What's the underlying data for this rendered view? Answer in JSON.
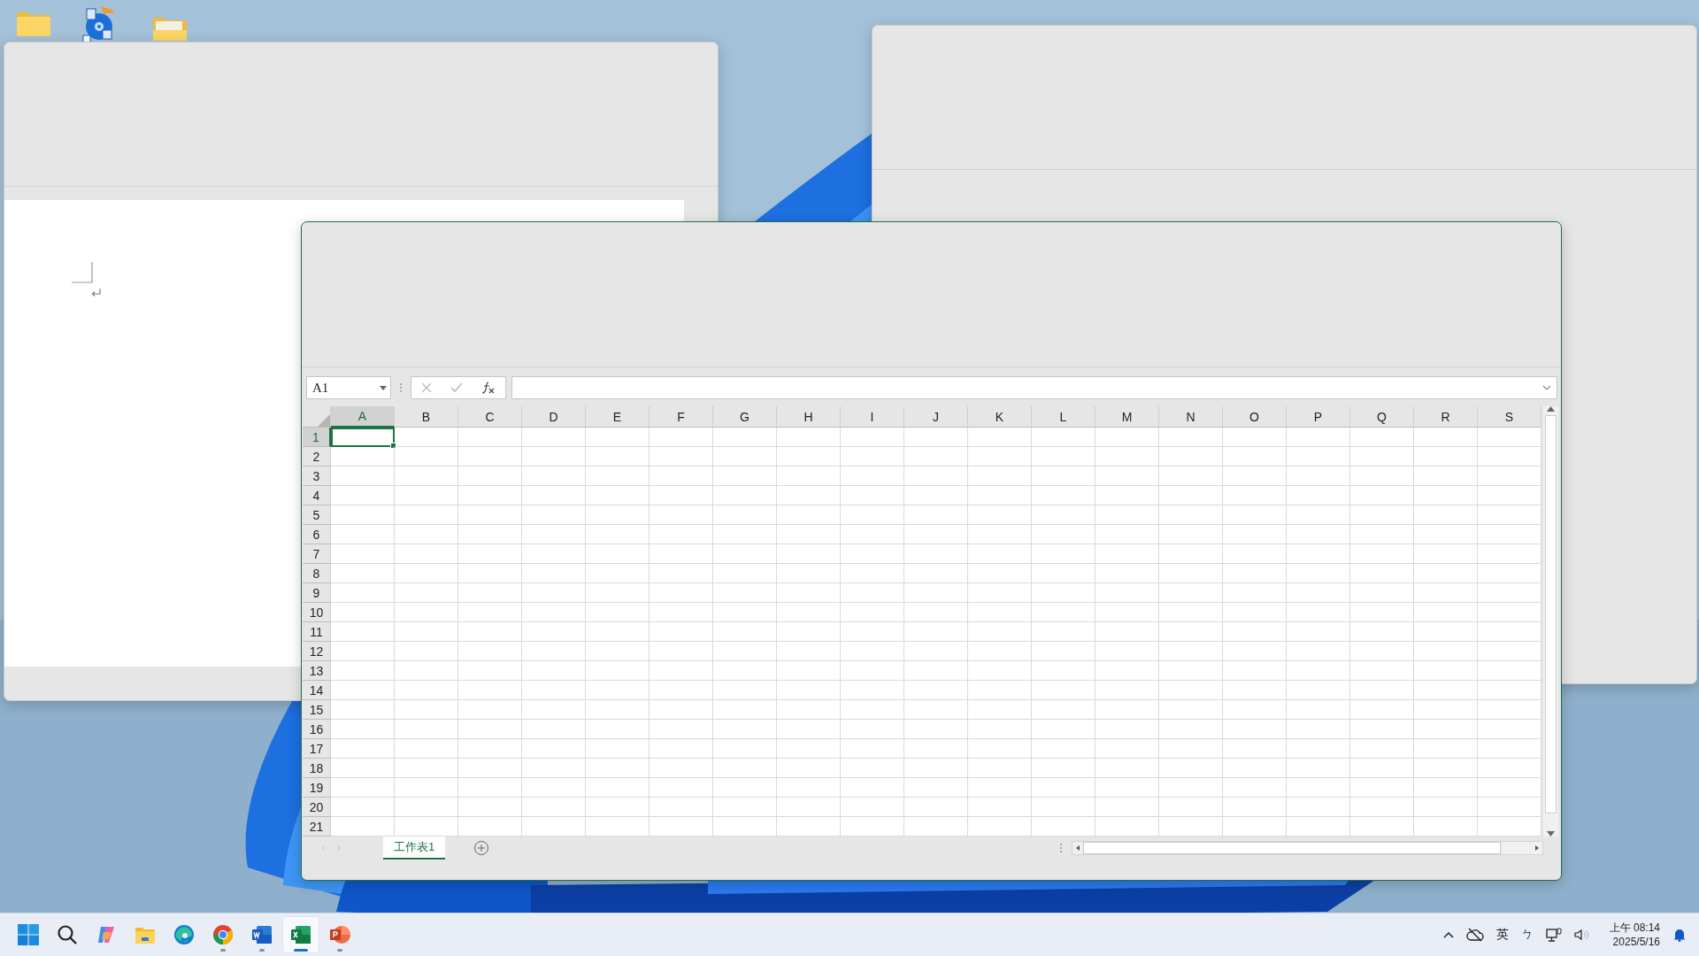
{
  "desktop_icons": [
    {
      "kind": "folder"
    },
    {
      "kind": "disc"
    },
    {
      "kind": "folder-open"
    }
  ],
  "excel": {
    "name_box": "A1",
    "columns": [
      {
        "label": "A",
        "selected": true
      },
      {
        "label": "B",
        "selected": false
      },
      {
        "label": "C",
        "selected": false
      },
      {
        "label": "D",
        "selected": false
      },
      {
        "label": "E",
        "selected": false
      },
      {
        "label": "F",
        "selected": false
      },
      {
        "label": "G",
        "selected": false
      },
      {
        "label": "H",
        "selected": false
      },
      {
        "label": "I",
        "selected": false
      },
      {
        "label": "J",
        "selected": false
      },
      {
        "label": "K",
        "selected": false
      },
      {
        "label": "L",
        "selected": false
      },
      {
        "label": "M",
        "selected": false
      },
      {
        "label": "N",
        "selected": false
      },
      {
        "label": "O",
        "selected": false
      },
      {
        "label": "P",
        "selected": false
      },
      {
        "label": "Q",
        "selected": false
      },
      {
        "label": "R",
        "selected": false
      },
      {
        "label": "S",
        "selected": false
      }
    ],
    "rows": [
      {
        "label": "1",
        "selected": true
      },
      {
        "label": "2",
        "selected": false
      },
      {
        "label": "3",
        "selected": false
      },
      {
        "label": "4",
        "selected": false
      },
      {
        "label": "5",
        "selected": false
      },
      {
        "label": "6",
        "selected": false
      },
      {
        "label": "7",
        "selected": false
      },
      {
        "label": "8",
        "selected": false
      },
      {
        "label": "9",
        "selected": false
      },
      {
        "label": "10",
        "selected": false
      },
      {
        "label": "11",
        "selected": false
      },
      {
        "label": "12",
        "selected": false
      },
      {
        "label": "13",
        "selected": false
      },
      {
        "label": "14",
        "selected": false
      },
      {
        "label": "15",
        "selected": false
      },
      {
        "label": "16",
        "selected": false
      },
      {
        "label": "17",
        "selected": false
      },
      {
        "label": "18",
        "selected": false
      },
      {
        "label": "19",
        "selected": false
      },
      {
        "label": "20",
        "selected": false
      },
      {
        "label": "21",
        "selected": false
      }
    ],
    "sheet_tabs": [
      {
        "label": "工作表1",
        "selected": true
      }
    ]
  },
  "taskbar": {
    "apps": [
      {
        "kind": "start",
        "running": false,
        "selected": false
      },
      {
        "kind": "search",
        "running": false,
        "selected": false
      },
      {
        "kind": "copilot",
        "running": false,
        "selected": false
      },
      {
        "kind": "explorer",
        "running": false,
        "selected": false
      },
      {
        "kind": "edge",
        "running": false,
        "selected": false
      },
      {
        "kind": "chrome",
        "running": true,
        "selected": false
      },
      {
        "kind": "word",
        "running": true,
        "selected": false
      },
      {
        "kind": "excel",
        "running": true,
        "selected": true
      },
      {
        "kind": "powerpoint",
        "running": true,
        "selected": false
      }
    ],
    "input_language": "英",
    "ime_mode": "ㄅ",
    "time": "上午 08:14",
    "date": "2025/5/16"
  }
}
